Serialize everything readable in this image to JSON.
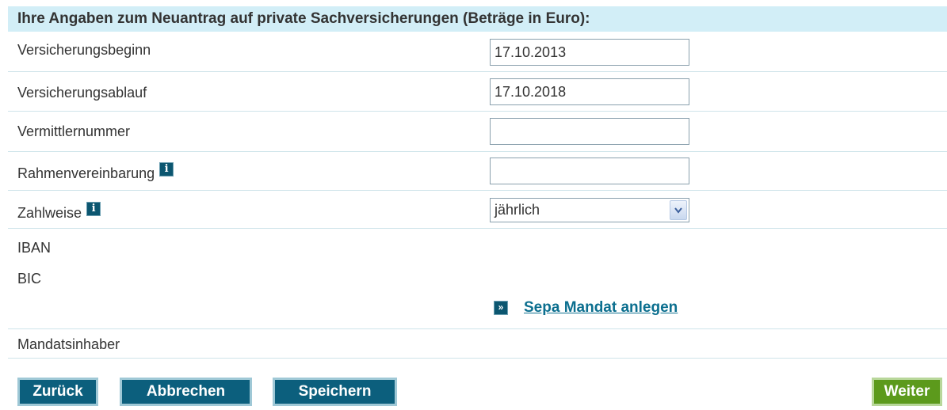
{
  "form": {
    "header": "Ihre Angaben zum Neuantrag auf private Sachversicherungen (Beträge in Euro):",
    "fields": {
      "versicherungsbeginn": {
        "label": "Versicherungsbeginn",
        "value": "17.10.2013"
      },
      "versicherungsablauf": {
        "label": "Versicherungsablauf",
        "value": "17.10.2018"
      },
      "vermittlernummer": {
        "label": "Vermittlernummer",
        "value": ""
      },
      "rahmenvereinbarung": {
        "label": "Rahmenvereinbarung",
        "value": ""
      },
      "zahlweise": {
        "label": "Zahlweise",
        "selected": "jährlich"
      },
      "iban": {
        "label": "IBAN"
      },
      "bic": {
        "label": "BIC"
      },
      "mandatsinhaber": {
        "label": "Mandatsinhaber"
      }
    },
    "sepa_link": "Sepa Mandat anlegen",
    "sepa_icon_glyph": "»",
    "info_icon_glyph": "i"
  },
  "buttons": {
    "back": "Zurück",
    "cancel": "Abbrechen",
    "save": "Speichern",
    "next": "Weiter"
  },
  "colors": {
    "header_bg": "#d2eef7",
    "primary_button": "#0c5f7d",
    "next_button": "#5c9a1c",
    "link": "#0c6f8f"
  }
}
